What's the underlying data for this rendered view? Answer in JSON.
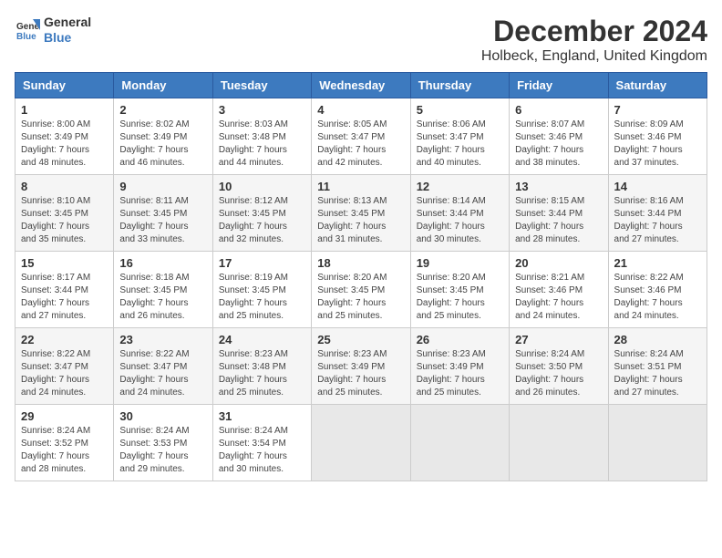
{
  "logo": {
    "line1": "General",
    "line2": "Blue"
  },
  "title": "December 2024",
  "location": "Holbeck, England, United Kingdom",
  "header": {
    "accent_color": "#3d7abf"
  },
  "weekdays": [
    "Sunday",
    "Monday",
    "Tuesday",
    "Wednesday",
    "Thursday",
    "Friday",
    "Saturday"
  ],
  "weeks": [
    [
      {
        "day": "1",
        "info": "Sunrise: 8:00 AM\nSunset: 3:49 PM\nDaylight: 7 hours\nand 48 minutes."
      },
      {
        "day": "2",
        "info": "Sunrise: 8:02 AM\nSunset: 3:49 PM\nDaylight: 7 hours\nand 46 minutes."
      },
      {
        "day": "3",
        "info": "Sunrise: 8:03 AM\nSunset: 3:48 PM\nDaylight: 7 hours\nand 44 minutes."
      },
      {
        "day": "4",
        "info": "Sunrise: 8:05 AM\nSunset: 3:47 PM\nDaylight: 7 hours\nand 42 minutes."
      },
      {
        "day": "5",
        "info": "Sunrise: 8:06 AM\nSunset: 3:47 PM\nDaylight: 7 hours\nand 40 minutes."
      },
      {
        "day": "6",
        "info": "Sunrise: 8:07 AM\nSunset: 3:46 PM\nDaylight: 7 hours\nand 38 minutes."
      },
      {
        "day": "7",
        "info": "Sunrise: 8:09 AM\nSunset: 3:46 PM\nDaylight: 7 hours\nand 37 minutes."
      }
    ],
    [
      {
        "day": "8",
        "info": "Sunrise: 8:10 AM\nSunset: 3:45 PM\nDaylight: 7 hours\nand 35 minutes."
      },
      {
        "day": "9",
        "info": "Sunrise: 8:11 AM\nSunset: 3:45 PM\nDaylight: 7 hours\nand 33 minutes."
      },
      {
        "day": "10",
        "info": "Sunrise: 8:12 AM\nSunset: 3:45 PM\nDaylight: 7 hours\nand 32 minutes."
      },
      {
        "day": "11",
        "info": "Sunrise: 8:13 AM\nSunset: 3:45 PM\nDaylight: 7 hours\nand 31 minutes."
      },
      {
        "day": "12",
        "info": "Sunrise: 8:14 AM\nSunset: 3:44 PM\nDaylight: 7 hours\nand 30 minutes."
      },
      {
        "day": "13",
        "info": "Sunrise: 8:15 AM\nSunset: 3:44 PM\nDaylight: 7 hours\nand 28 minutes."
      },
      {
        "day": "14",
        "info": "Sunrise: 8:16 AM\nSunset: 3:44 PM\nDaylight: 7 hours\nand 27 minutes."
      }
    ],
    [
      {
        "day": "15",
        "info": "Sunrise: 8:17 AM\nSunset: 3:44 PM\nDaylight: 7 hours\nand 27 minutes."
      },
      {
        "day": "16",
        "info": "Sunrise: 8:18 AM\nSunset: 3:45 PM\nDaylight: 7 hours\nand 26 minutes."
      },
      {
        "day": "17",
        "info": "Sunrise: 8:19 AM\nSunset: 3:45 PM\nDaylight: 7 hours\nand 25 minutes."
      },
      {
        "day": "18",
        "info": "Sunrise: 8:20 AM\nSunset: 3:45 PM\nDaylight: 7 hours\nand 25 minutes."
      },
      {
        "day": "19",
        "info": "Sunrise: 8:20 AM\nSunset: 3:45 PM\nDaylight: 7 hours\nand 25 minutes."
      },
      {
        "day": "20",
        "info": "Sunrise: 8:21 AM\nSunset: 3:46 PM\nDaylight: 7 hours\nand 24 minutes."
      },
      {
        "day": "21",
        "info": "Sunrise: 8:22 AM\nSunset: 3:46 PM\nDaylight: 7 hours\nand 24 minutes."
      }
    ],
    [
      {
        "day": "22",
        "info": "Sunrise: 8:22 AM\nSunset: 3:47 PM\nDaylight: 7 hours\nand 24 minutes."
      },
      {
        "day": "23",
        "info": "Sunrise: 8:22 AM\nSunset: 3:47 PM\nDaylight: 7 hours\nand 24 minutes."
      },
      {
        "day": "24",
        "info": "Sunrise: 8:23 AM\nSunset: 3:48 PM\nDaylight: 7 hours\nand 25 minutes."
      },
      {
        "day": "25",
        "info": "Sunrise: 8:23 AM\nSunset: 3:49 PM\nDaylight: 7 hours\nand 25 minutes."
      },
      {
        "day": "26",
        "info": "Sunrise: 8:23 AM\nSunset: 3:49 PM\nDaylight: 7 hours\nand 25 minutes."
      },
      {
        "day": "27",
        "info": "Sunrise: 8:24 AM\nSunset: 3:50 PM\nDaylight: 7 hours\nand 26 minutes."
      },
      {
        "day": "28",
        "info": "Sunrise: 8:24 AM\nSunset: 3:51 PM\nDaylight: 7 hours\nand 27 minutes."
      }
    ],
    [
      {
        "day": "29",
        "info": "Sunrise: 8:24 AM\nSunset: 3:52 PM\nDaylight: 7 hours\nand 28 minutes."
      },
      {
        "day": "30",
        "info": "Sunrise: 8:24 AM\nSunset: 3:53 PM\nDaylight: 7 hours\nand 29 minutes."
      },
      {
        "day": "31",
        "info": "Sunrise: 8:24 AM\nSunset: 3:54 PM\nDaylight: 7 hours\nand 30 minutes."
      },
      null,
      null,
      null,
      null
    ]
  ]
}
